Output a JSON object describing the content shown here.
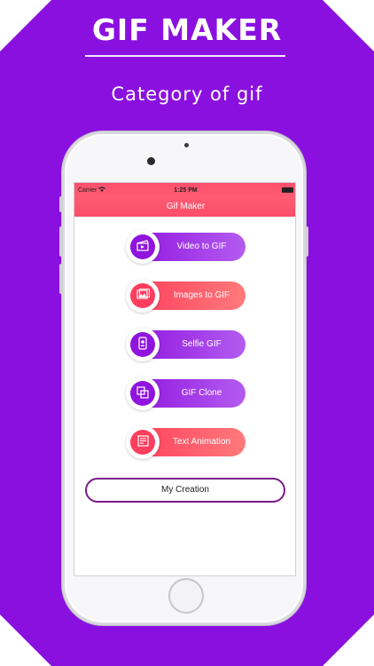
{
  "header": {
    "title": "GIF MAKER",
    "subtitle": "Category of gif"
  },
  "colors": {
    "background_purple": "#8a10e0",
    "nav_red": "#ff5b72",
    "button_purple": "#8f14de",
    "button_red": "#ff3d5d",
    "outline_button": "#7a1a8a"
  },
  "status_bar": {
    "carrier": "Carrier",
    "time": "1:25 PM"
  },
  "navbar": {
    "title": "Gif Maker"
  },
  "menu": {
    "items": [
      {
        "label": "Video to GIF",
        "icon": "video-clapper-icon",
        "style": "purple"
      },
      {
        "label": "Images to GIF",
        "icon": "images-icon",
        "style": "red"
      },
      {
        "label": "Selfie GIF",
        "icon": "selfie-phone-icon",
        "style": "purple"
      },
      {
        "label": "GIF Clone",
        "icon": "clone-icon",
        "style": "purple"
      },
      {
        "label": "Text Animation",
        "icon": "text-document-icon",
        "style": "red"
      }
    ]
  },
  "creation_button": {
    "label": "My Creation"
  }
}
